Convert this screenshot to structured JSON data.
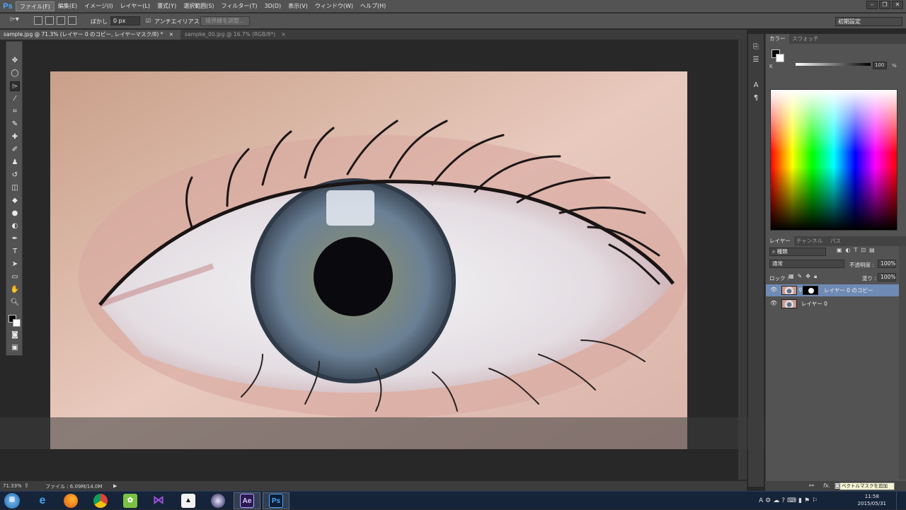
{
  "app": {
    "logo": "Ps"
  },
  "menu": [
    {
      "label": "ファイル(F)",
      "active": true
    },
    {
      "label": "編集(E)"
    },
    {
      "label": "イメージ(I)"
    },
    {
      "label": "レイヤー(L)"
    },
    {
      "label": "書式(Y)"
    },
    {
      "label": "選択範囲(S)"
    },
    {
      "label": "フィルター(T)"
    },
    {
      "label": "3D(D)"
    },
    {
      "label": "表示(V)"
    },
    {
      "label": "ウィンドウ(W)"
    },
    {
      "label": "ヘルプ(H)"
    }
  ],
  "options": {
    "feather_label": "ぼかし :",
    "feather_value": "0 px",
    "antialias_label": "アンチエイリアス",
    "antialias_checked": true,
    "refine_edge": "境界線を調整...",
    "workspace": "初期設定"
  },
  "tabs": [
    {
      "label": "sample.jpg @ 71.3% (レイヤー 0 のコピー, レイヤーマスク/8) *",
      "close": "×"
    },
    {
      "label": "sampke_00.jpg @ 16.7% (RGB/8*)",
      "close": "×"
    }
  ],
  "status": {
    "zoom": "71.33%",
    "file_info": "ファイル : 6.09M/14.0M"
  },
  "color_panel": {
    "tabs": [
      "カラー",
      "スウォッチ"
    ],
    "channel_label": "K",
    "value": "100",
    "unit": "%"
  },
  "layers_panel": {
    "tabs": [
      "レイヤー",
      "チャンネル",
      "パス"
    ],
    "filter_label": "種類",
    "blend_mode": "通常",
    "opacity_label": "不透明度 :",
    "opacity_value": "100%",
    "lock_label": "ロック :",
    "fill_label": "塗り :",
    "fill_value": "100%",
    "layers": [
      {
        "name": "レイヤー 0 のコピー",
        "selected": true
      },
      {
        "name": "レイヤー 0",
        "selected": false
      }
    ],
    "tooltip": "ベクトルマスクを追加"
  },
  "taskbar": {
    "time": "11:58",
    "date": "2015/05/31",
    "apps": [
      "windows-start",
      "internet-explorer",
      "firefox",
      "chrome",
      "evernote",
      "visual-studio",
      "inkscape",
      "eclipse",
      "after-effects",
      "photoshop"
    ]
  },
  "colors": {
    "panel_bg": "#535353",
    "selected_layer": "#6f8ab4",
    "ps_blue": "#4fa7ff",
    "ae_purple": "#2b1b52"
  }
}
